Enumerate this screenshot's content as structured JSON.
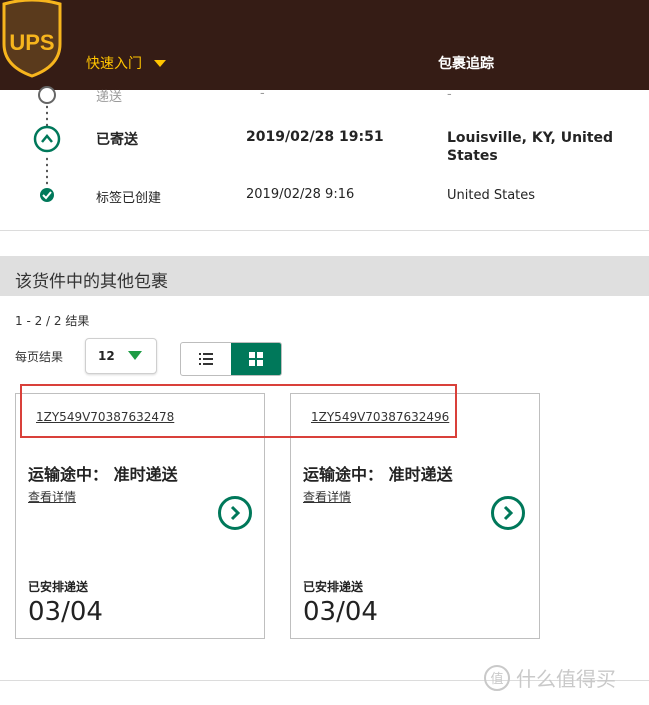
{
  "header": {
    "logo_text": "UPS",
    "quick_start_label": "快速入门",
    "page_title": "包裹追踪",
    "colors": {
      "bar": "#351c15",
      "accent": "#ffc400",
      "logo_gold": "#f7b51d"
    }
  },
  "timeline": [
    {
      "status": "递送",
      "date": "-",
      "location": "-",
      "state": "faded"
    },
    {
      "status": "已寄送",
      "date": "2019/02/28  19:51",
      "location": "Louisville, KY, United States",
      "state": "current"
    },
    {
      "status": "标签已创建",
      "date": "2019/02/28  9:16",
      "location": "United States",
      "state": "done"
    }
  ],
  "section": {
    "title": "该货件中的其他包裹",
    "results_text": "1 - 2 / 2 结果",
    "per_page_label": "每页结果",
    "per_page_value": "12",
    "view_modes": [
      "list",
      "grid"
    ],
    "active_view": "grid"
  },
  "packages": [
    {
      "tracking": "1ZY549V70387632478",
      "status": "运输途中： 准时递送",
      "detail_link": "查看详情",
      "scheduled_label": "已安排递送",
      "date": "03/04"
    },
    {
      "tracking": "1ZY549V70387632496",
      "status": "运输途中： 准时递送",
      "detail_link": "查看详情",
      "scheduled_label": "已安排递送",
      "date": "03/04"
    }
  ],
  "watermark": {
    "icon_text": "值",
    "text": "什么值得买"
  },
  "colors": {
    "green": "#00785a",
    "highlight_red": "#d9403a",
    "section_bg": "#dfdfdf"
  }
}
